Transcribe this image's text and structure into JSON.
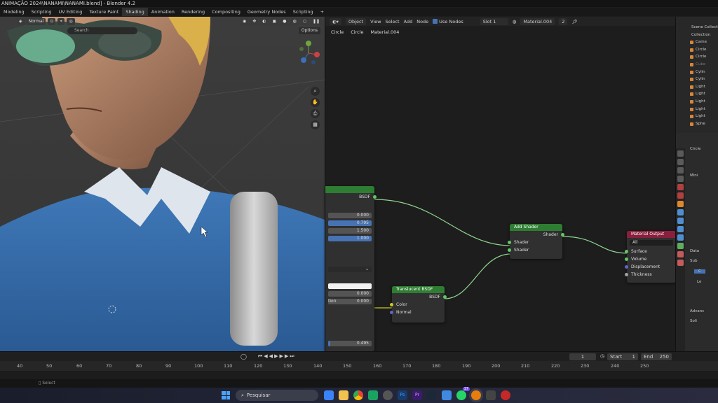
{
  "window": {
    "title": "ANIMAÇÃO 2024\\NANAMI\\NANAMI.blend] - Blender 4.2"
  },
  "menu_tabs": [
    "Modeling",
    "Scripting",
    "UV Editing",
    "Texture Paint",
    "Shading",
    "Animation",
    "Rendering",
    "Compositing",
    "Geometry Nodes",
    "Scripting",
    "+"
  ],
  "active_tab_index": 4,
  "viewport": {
    "shading_mode": "Normal",
    "search_placeholder": "Search",
    "options_label": "Options"
  },
  "node_editor": {
    "mode": "Object",
    "menus": [
      "View",
      "Select",
      "Add",
      "Node"
    ],
    "use_nodes_label": "Use Nodes",
    "slot": "Slot 1",
    "material": "Material.004",
    "user_count": "2",
    "breadcrumb": [
      "Circle",
      "Circle",
      "Material.004"
    ],
    "principled_node": {
      "output_label": "BSDF",
      "values": [
        "0.000",
        "0.795",
        "1.500",
        "1.000"
      ],
      "extra_values": [
        "0.000",
        "0.000"
      ],
      "extra_row_label": "tion",
      "bottom_value": "0.495"
    },
    "add_shader_node": {
      "title": "Add Shader",
      "output": "Shader",
      "inputs": [
        "Shader",
        "Shader"
      ]
    },
    "translucent_node": {
      "title": "Translucent BSDF",
      "output": "BSDF",
      "inputs": [
        "Color",
        "Normal"
      ]
    },
    "material_output_node": {
      "title": "Material Output",
      "target": "All",
      "inputs": [
        "Surface",
        "Volume",
        "Displacement",
        "Thickness"
      ]
    }
  },
  "timeline": {
    "current_frame": "1",
    "start_label": "Start",
    "start": "1",
    "end_label": "End",
    "end": "250",
    "ruler": [
      "40",
      "50",
      "60",
      "70",
      "80",
      "90",
      "100",
      "110",
      "120",
      "130",
      "140",
      "150",
      "160",
      "170",
      "180",
      "190",
      "200",
      "210",
      "220",
      "230",
      "240",
      "250"
    ]
  },
  "outliner": {
    "header": "Scene Collection",
    "items": [
      "Collection",
      "Came",
      "Circle",
      "Circle",
      "Cube",
      "Cylin",
      "Cylin",
      "Light",
      "Light",
      "Light",
      "Light",
      "Light",
      "Sphe"
    ]
  },
  "properties": {
    "object_name": "Circle",
    "rows": [
      "Mini",
      "Data",
      "Sub",
      "C",
      "Le",
      "Advanc",
      "Soli"
    ]
  },
  "status": {
    "select_label": "Select"
  },
  "taskbar": {
    "search_placeholder": "Pesquisar",
    "apps": [
      {
        "name": "widgets",
        "color": "#3b82f6"
      },
      {
        "name": "file-explorer",
        "color": "#f2c14e"
      },
      {
        "name": "chrome",
        "color": "#e94335"
      },
      {
        "name": "security",
        "color": "#1aa260"
      },
      {
        "name": "obs",
        "color": "#555"
      },
      {
        "name": "Ps",
        "color": "#1a3a6b"
      },
      {
        "name": "Pr",
        "color": "#3a1c6b"
      },
      {
        "name": "steam",
        "color": "#1b2838"
      },
      {
        "name": "mail",
        "color": "#3f8ae0"
      },
      {
        "name": "whatsapp",
        "color": "#25d366"
      },
      {
        "name": "blender",
        "color": "#e87d0d"
      },
      {
        "name": "calculator",
        "color": "#444"
      },
      {
        "name": "recorder",
        "color": "#c62828"
      }
    ],
    "badge": "17"
  }
}
